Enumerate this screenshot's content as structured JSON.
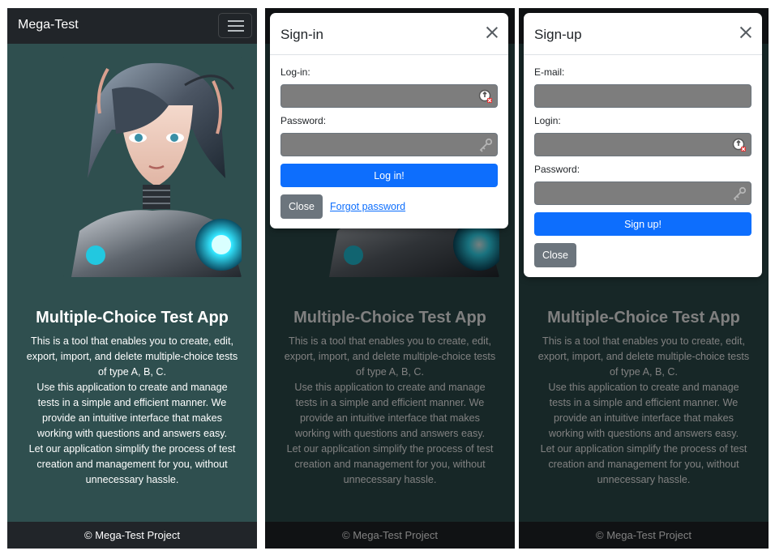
{
  "app": {
    "brand": "Mega-Test",
    "title": "Multiple-Choice Test App",
    "description": [
      "This is a tool that enables you to create, edit, export, import, and delete multiple-choice tests of type A, B, C.",
      "Use this application to create and manage tests in a simple and efficient manner. We provide an intuitive interface that makes working with questions and answers easy.",
      "Let our application simplify the process of test creation and management for you, without unnecessary hassle."
    ],
    "footer": "© Mega-Test Project",
    "hero_image": "anime-cyborg-girl-illustration"
  },
  "signin": {
    "title": "Sign-in",
    "login_label": "Log-in:",
    "login_value": "",
    "password_label": "Password:",
    "password_value": "",
    "submit_label": "Log in!",
    "close_label": "Close",
    "forgot_label": "Forgot password"
  },
  "signup": {
    "title": "Sign-up",
    "email_label": "E-mail:",
    "email_value": "",
    "login_label": "Login:",
    "login_value": "",
    "password_label": "Password:",
    "password_value": "",
    "submit_label": "Sign up!",
    "close_label": "Close"
  },
  "icons": {
    "login_field": "password-manager-key-icon",
    "password_field": "key-icon",
    "close": "close-icon",
    "menu": "hamburger-menu-icon"
  },
  "colors": {
    "page_bg": "#2f4f4f",
    "navbar": "#212529",
    "primary": "#0d6efd",
    "secondary": "#6c757d",
    "input_bg": "#7d7d7d"
  }
}
